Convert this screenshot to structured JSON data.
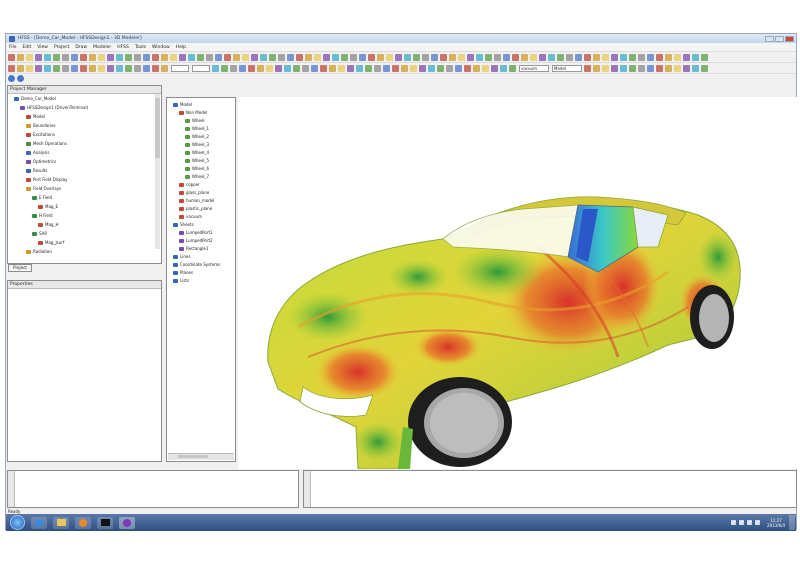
{
  "window": {
    "title": "HFSS - [Demo_Car_Model - HFSSDesign1 - 3D Modeler]"
  },
  "menu": [
    "File",
    "Edit",
    "View",
    "Project",
    "Draw",
    "Modeler",
    "HFSS",
    "Tools",
    "Window",
    "Help"
  ],
  "toolbar": {
    "combo_1": "",
    "combo_2": "",
    "material": "vacuum",
    "model": "Model"
  },
  "project_manager": {
    "title": "Project Manager",
    "tab": "Project",
    "items": [
      {
        "label": "Demo_Car_Model",
        "level": 0,
        "color": "#3a64b8"
      },
      {
        "label": "HFSSDesign1 (DrivenTerminal)",
        "level": 1,
        "color": "#7a4ca8"
      },
      {
        "label": "Model",
        "level": 2,
        "color": "#c04a3a"
      },
      {
        "label": "Boundaries",
        "level": 2,
        "color": "#d09a2a"
      },
      {
        "label": "Excitations",
        "level": 2,
        "color": "#c04a3a"
      },
      {
        "label": "Mesh Operations",
        "level": 2,
        "color": "#4a8a3a"
      },
      {
        "label": "Analysis",
        "level": 2,
        "color": "#3a64b8"
      },
      {
        "label": "Optimetrics",
        "level": 2,
        "color": "#7a4ca8"
      },
      {
        "label": "Results",
        "level": 2,
        "color": "#3a64b8"
      },
      {
        "label": "Port Field Display",
        "level": 2,
        "color": "#c04a3a"
      },
      {
        "label": "Field Overlays",
        "level": 2,
        "color": "#d09a2a"
      },
      {
        "label": "E Field",
        "level": 3,
        "color": "#3a8a4a"
      },
      {
        "label": "Mag_E",
        "level": 4,
        "color": "#c04a3a"
      },
      {
        "label": "H Field",
        "level": 3,
        "color": "#3a8a4a"
      },
      {
        "label": "Mag_H",
        "level": 4,
        "color": "#c04a3a"
      },
      {
        "label": "SAR",
        "level": 3,
        "color": "#3a8a4a"
      },
      {
        "label": "Mag_Jsurf",
        "level": 4,
        "color": "#c04a3a"
      },
      {
        "label": "Radiation",
        "level": 2,
        "color": "#d09a2a"
      }
    ]
  },
  "properties": {
    "title": "Properties"
  },
  "model_tree": {
    "items": [
      {
        "label": "Model",
        "level": 0,
        "color": "#3a64b8"
      },
      {
        "label": "Non Model",
        "level": 1,
        "color": "#c04a3a"
      },
      {
        "label": "Wheel",
        "level": 2,
        "color": "#5a9a4a"
      },
      {
        "label": "Wheel_1",
        "level": 2,
        "color": "#5a9a4a"
      },
      {
        "label": "Wheel_2",
        "level": 2,
        "color": "#5a9a4a"
      },
      {
        "label": "Wheel_3",
        "level": 2,
        "color": "#5a9a4a"
      },
      {
        "label": "Wheel_4",
        "level": 2,
        "color": "#5a9a4a"
      },
      {
        "label": "Wheel_5",
        "level": 2,
        "color": "#5a9a4a"
      },
      {
        "label": "Wheel_6",
        "level": 2,
        "color": "#5a9a4a"
      },
      {
        "label": "Wheel_7",
        "level": 2,
        "color": "#5a9a4a"
      },
      {
        "label": "copper",
        "level": 1,
        "color": "#c04a3a"
      },
      {
        "label": "glass_plane",
        "level": 1,
        "color": "#c04a3a"
      },
      {
        "label": "human_model",
        "level": 1,
        "color": "#c04a3a"
      },
      {
        "label": "plastic_plane",
        "level": 1,
        "color": "#c04a3a"
      },
      {
        "label": "vacuum",
        "level": 1,
        "color": "#c04a3a"
      },
      {
        "label": "Sheets",
        "level": 0,
        "color": "#3a64b8"
      },
      {
        "label": "LumpedPort1",
        "level": 1,
        "color": "#7a4ca8"
      },
      {
        "label": "LumpedPort2",
        "level": 1,
        "color": "#7a4ca8"
      },
      {
        "label": "Rectangle1",
        "level": 1,
        "color": "#7a4ca8"
      },
      {
        "label": "Lines",
        "level": 0,
        "color": "#3a64b8"
      },
      {
        "label": "Coordinate Systems",
        "level": 0,
        "color": "#3a64b8"
      },
      {
        "label": "Planes",
        "level": 0,
        "color": "#3a64b8"
      },
      {
        "label": "Lists",
        "level": 0,
        "color": "#3a64b8"
      }
    ]
  },
  "status": {
    "text": "Ready"
  },
  "taskbar": {
    "clock_time": "11:27",
    "clock_date": "2013/6/4"
  },
  "colors": {
    "accent": "#3a64b8",
    "field_high": "#d8322a",
    "field_mid": "#e8d83a",
    "field_low": "#4ab83a"
  }
}
